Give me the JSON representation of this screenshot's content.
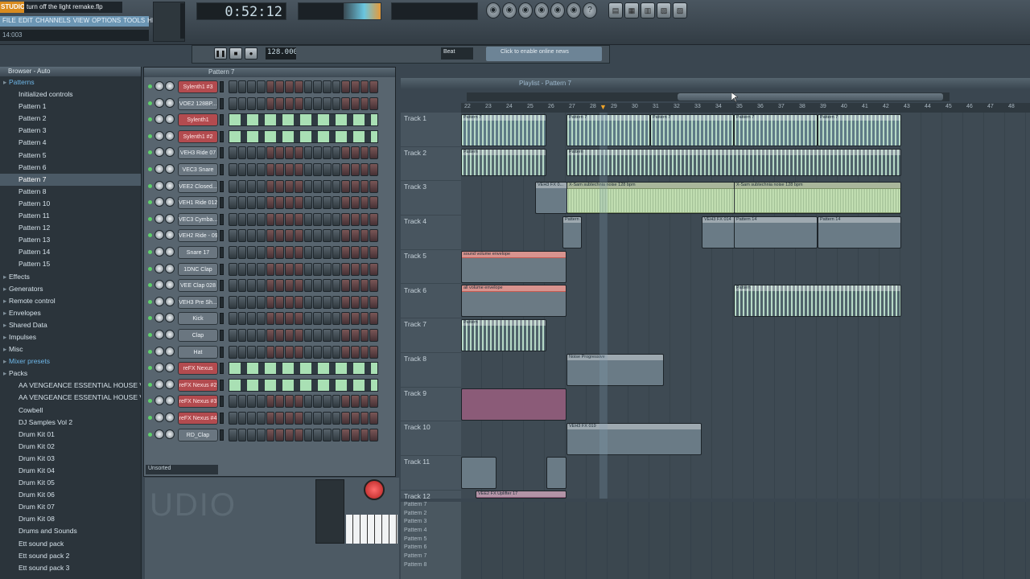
{
  "app": {
    "logo": "STUDIO",
    "project_title": "turn off the light remake.flp",
    "hint": "14:003",
    "time": "0:52:12",
    "unsorted": "Unsorted",
    "watermark": "UDIO",
    "online_news": "Click to enable online news"
  },
  "menu": [
    "FILE",
    "EDIT",
    "CHANNELS",
    "VIEW",
    "OPTIONS",
    "TOOLS",
    "HELP"
  ],
  "transport": {
    "pattern_name": "Pattern 7",
    "bpm": "128.000",
    "beat_mode": "Beat",
    "playlist_title": "Playlist - Pattern 7"
  },
  "browser": {
    "title": "Browser - Auto",
    "items": [
      {
        "label": "Patterns",
        "type": "cat"
      },
      {
        "label": "Initialized controls",
        "type": "item"
      },
      {
        "label": "Pattern 1",
        "type": "item"
      },
      {
        "label": "Pattern 2",
        "type": "item"
      },
      {
        "label": "Pattern 3",
        "type": "item"
      },
      {
        "label": "Pattern 4",
        "type": "item"
      },
      {
        "label": "Pattern 5",
        "type": "item"
      },
      {
        "label": "Pattern 6",
        "type": "item"
      },
      {
        "label": "Pattern 7",
        "type": "sel"
      },
      {
        "label": "Pattern 8",
        "type": "item"
      },
      {
        "label": "Pattern 10",
        "type": "item"
      },
      {
        "label": "Pattern 11",
        "type": "item"
      },
      {
        "label": "Pattern 12",
        "type": "item"
      },
      {
        "label": "Pattern 13",
        "type": "item"
      },
      {
        "label": "Pattern 14",
        "type": "item"
      },
      {
        "label": "Pattern 15",
        "type": "item"
      },
      {
        "label": "Effects",
        "type": "cat2"
      },
      {
        "label": "Generators",
        "type": "cat2"
      },
      {
        "label": "Remote control",
        "type": "cat2"
      },
      {
        "label": "Envelopes",
        "type": "cat2"
      },
      {
        "label": "Shared Data",
        "type": "cat2"
      },
      {
        "label": "Impulses",
        "type": "cat2"
      },
      {
        "label": "Misc",
        "type": "cat2"
      },
      {
        "label": "Mixer presets",
        "type": "cat"
      },
      {
        "label": "Packs",
        "type": "cat2"
      },
      {
        "label": "AA VENGEANCE ESSENTIAL HOUSE VO...",
        "type": "item"
      },
      {
        "label": "AA VENGEANCE ESSENTIAL HOUSE VO...",
        "type": "item"
      },
      {
        "label": "Cowbell",
        "type": "item"
      },
      {
        "label": "DJ Samples Vol 2",
        "type": "item"
      },
      {
        "label": "Drum Kit 01",
        "type": "item"
      },
      {
        "label": "Drum Kit 02",
        "type": "item"
      },
      {
        "label": "Drum Kit 03",
        "type": "item"
      },
      {
        "label": "Drum Kit 04",
        "type": "item"
      },
      {
        "label": "Drum Kit 05",
        "type": "item"
      },
      {
        "label": "Drum Kit 06",
        "type": "item"
      },
      {
        "label": "Drum Kit 07",
        "type": "item"
      },
      {
        "label": "Drum Kit 08",
        "type": "item"
      },
      {
        "label": "Drums and Sounds",
        "type": "item"
      },
      {
        "label": "Ett sound pack",
        "type": "item"
      },
      {
        "label": "Ett sound pack 2",
        "type": "item"
      },
      {
        "label": "Ett sound pack 3",
        "type": "item"
      }
    ]
  },
  "channels": [
    {
      "name": "Sylenth1 #3",
      "red": true,
      "roll": false
    },
    {
      "name": "VOE2 128BP...",
      "red": false,
      "roll": false
    },
    {
      "name": "Sylenth1",
      "red": true,
      "roll": true
    },
    {
      "name": "Sylenth1 #2",
      "red": true,
      "roll": true
    },
    {
      "name": "VEH3 Ride 07",
      "red": false,
      "roll": false
    },
    {
      "name": "VEC3 Snare",
      "red": false,
      "roll": false
    },
    {
      "name": "VEE2 Closed...",
      "red": false,
      "roll": false
    },
    {
      "name": "VEH1 Ride 012",
      "red": false,
      "roll": false
    },
    {
      "name": "VEC3 Cymba...",
      "red": false,
      "roll": false
    },
    {
      "name": "VEH2 Ride - 09",
      "red": false,
      "roll": false
    },
    {
      "name": "Snare 17",
      "red": false,
      "roll": false
    },
    {
      "name": "1DNC Clap",
      "red": false,
      "roll": false
    },
    {
      "name": "VEE Clap 028",
      "red": false,
      "roll": false
    },
    {
      "name": "VEH3 Pre Sh...",
      "red": false,
      "roll": false
    },
    {
      "name": "Kick",
      "red": false,
      "roll": false
    },
    {
      "name": "Clap",
      "red": false,
      "roll": false
    },
    {
      "name": "Hat",
      "red": false,
      "roll": false
    },
    {
      "name": "reFX Nexus",
      "red": true,
      "roll": true
    },
    {
      "name": "reFX Nexus #2",
      "red": true,
      "roll": true
    },
    {
      "name": "reFX Nexus #3",
      "red": true,
      "roll": false
    },
    {
      "name": "reFX Nexus #4",
      "red": true,
      "roll": false
    },
    {
      "name": "RD_Clap",
      "red": false,
      "roll": false
    }
  ],
  "ruler": [
    "22",
    "23",
    "24",
    "25",
    "26",
    "27",
    "28",
    "29",
    "30",
    "31",
    "32",
    "33",
    "34",
    "35",
    "36",
    "37",
    "38",
    "39",
    "40",
    "41",
    "42",
    "43",
    "44",
    "45",
    "46",
    "47",
    "48"
  ],
  "tracks": [
    "Track 1",
    "Track 2",
    "Track 3",
    "Track 4",
    "Track 5",
    "Track 6",
    "Track 7",
    "Track 8",
    "Track 9",
    "Track 10",
    "Track 11",
    "Track 12"
  ],
  "clips": {
    "t1a": "Pattern 7",
    "t1b": "Pattern 7",
    "t1c": "Pattern 7",
    "t1d": "Pattern 7",
    "t1e": "Pattern 7",
    "t2a": "Pattern",
    "t3a": "VEH3 FX 0...",
    "t3b": "X-Sam subtechnia noise 128 bpm",
    "t3c": "X-Sam subtechnia noise 128 bpm",
    "t4a": "Pattern 1",
    "t4b": "VEH3 FX 014",
    "t4c": "Pattern 14",
    "t4d": "Pattern 14",
    "t5a": "sound volume envelope",
    "t6a": "all volume envelope",
    "t6b": "Pattern",
    "t7a": "Pattern",
    "t8a": "Noise Progressive",
    "t10a": "VEH3 FX 019",
    "t12a": "VEE2 FX Uplifter 17"
  },
  "lower_list": [
    "Pattern 7",
    "Pattern 2",
    "Pattern 3",
    "Pattern 4",
    "Pattern 5",
    "Pattern 6",
    "Pattern 7",
    "Pattern 8"
  ]
}
